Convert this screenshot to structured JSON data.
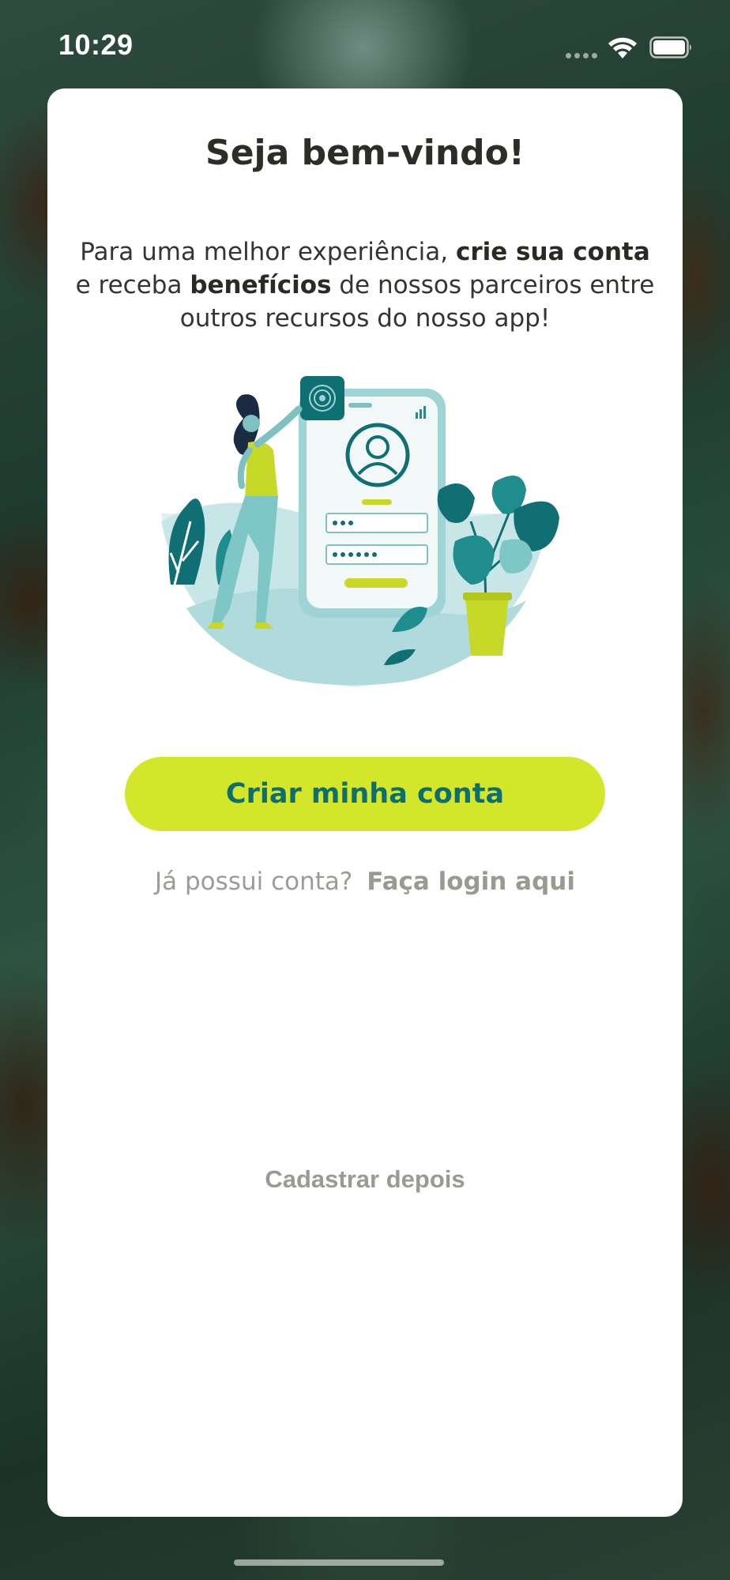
{
  "status_bar": {
    "time": "10:29",
    "icons": [
      "signal-icon",
      "wifi-icon",
      "battery-icon"
    ]
  },
  "welcome": {
    "title": "Seja bem-vindo!",
    "intro": {
      "part1": "Para uma melhor experiência, ",
      "bold1": "crie sua conta",
      "part2": " e receba ",
      "bold2": "benefícios",
      "part3": " de nossos parceiros entre outros recursos do nosso app!"
    },
    "illustration": "person-creating-account-illustration",
    "create_account_label": "Criar minha conta",
    "login_prompt": "Já possui conta?",
    "login_link": "Faça login aqui",
    "later_label": "Cadastrar depois"
  },
  "colors": {
    "accent": "#d3e62a",
    "button_text": "#0d6e6e",
    "teal": "#7fc6c6",
    "muted_text": "#9a9a92"
  }
}
